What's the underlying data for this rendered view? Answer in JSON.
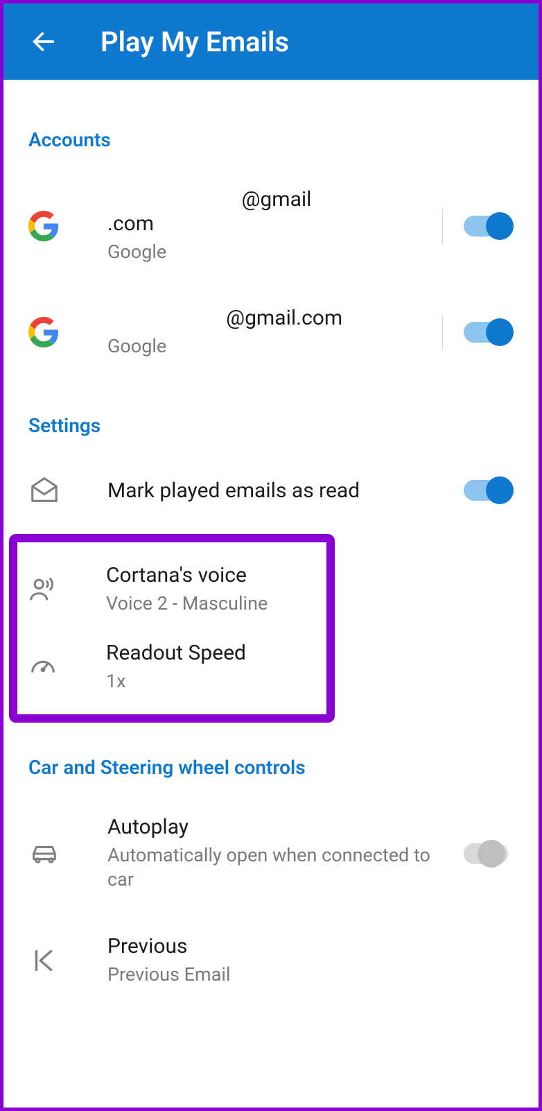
{
  "header": {
    "title": "Play My Emails"
  },
  "sections": {
    "accounts": {
      "header": "Accounts",
      "items": [
        {
          "email_part1": "                          @gmail",
          "email_part2": ".com",
          "provider": "Google",
          "enabled": true
        },
        {
          "email_part1": "                       @gmail.com",
          "email_part2": "",
          "provider": "Google",
          "enabled": true
        }
      ]
    },
    "settings": {
      "header": "Settings",
      "mark_read": {
        "title": "Mark played emails as read",
        "enabled": true
      },
      "voice": {
        "title": "Cortana's voice",
        "sub": "Voice 2 - Masculine"
      },
      "speed": {
        "title": "Readout Speed",
        "sub": "1x"
      }
    },
    "car": {
      "header": "Car and Steering wheel controls",
      "autoplay": {
        "title": "Autoplay",
        "sub": "Automatically open when connected to car",
        "enabled": false
      },
      "previous": {
        "title": "Previous",
        "sub": "Previous Email"
      }
    }
  }
}
